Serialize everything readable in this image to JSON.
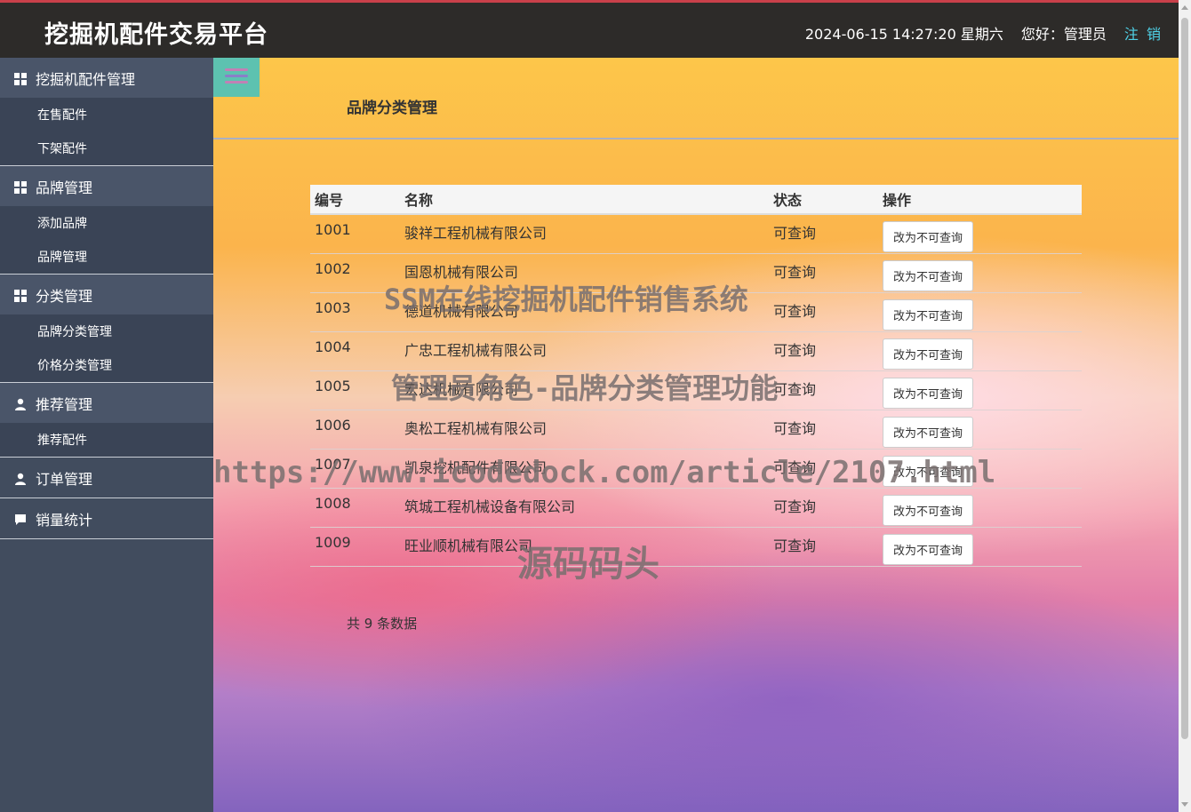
{
  "header": {
    "app_title": "挖掘机配件交易平台",
    "clock": "2024-06-15 14:27:20 星期六",
    "greeting": "您好：管理员",
    "logout": "注 销"
  },
  "sidebar": {
    "groups": [
      {
        "label": "挖掘机配件管理",
        "icon": "grid-icon",
        "items": [
          "在售配件",
          "下架配件"
        ]
      },
      {
        "label": "品牌管理",
        "icon": "grid-icon",
        "items": [
          "添加品牌",
          "品牌管理"
        ]
      },
      {
        "label": "分类管理",
        "icon": "grid-icon",
        "items": [
          "品牌分类管理",
          "价格分类管理"
        ]
      },
      {
        "label": "推荐管理",
        "icon": "user-icon",
        "items": [
          "推荐配件"
        ]
      },
      {
        "label": "订单管理",
        "icon": "user-icon",
        "items": []
      },
      {
        "label": "销量统计",
        "icon": "comment-icon",
        "items": []
      }
    ]
  },
  "main": {
    "heading": "品牌分类管理",
    "table": {
      "headers": [
        "编号",
        "名称",
        "状态",
        "操作"
      ],
      "rows": [
        {
          "id": "1001",
          "name": "骏祥工程机械有限公司",
          "status": "可查询",
          "action": "改为不可查询"
        },
        {
          "id": "1002",
          "name": "国恩机械有限公司",
          "status": "可查询",
          "action": "改为不可查询"
        },
        {
          "id": "1003",
          "name": "德道机械有限公司",
          "status": "可查询",
          "action": "改为不可查询"
        },
        {
          "id": "1004",
          "name": "广忠工程机械有限公司",
          "status": "可查询",
          "action": "改为不可查询"
        },
        {
          "id": "1005",
          "name": "宏达机械有限公司",
          "status": "可查询",
          "action": "改为不可查询"
        },
        {
          "id": "1006",
          "name": "奥松工程机械有限公司",
          "status": "可查询",
          "action": "改为不可查询"
        },
        {
          "id": "1007",
          "name": "凯泉挖机配件有限公司",
          "status": "可查询",
          "action": "改为不可查询"
        },
        {
          "id": "1008",
          "name": "筑城工程机械设备有限公司",
          "status": "可查询",
          "action": "改为不可查询"
        },
        {
          "id": "1009",
          "name": "旺业顺机械有限公司",
          "status": "可查询",
          "action": "改为不可查询"
        }
      ]
    },
    "count_text": "共 9 条数据"
  },
  "watermarks": [
    "SSM在线挖掘机配件销售系统",
    "管理员角色-品牌分类管理功能",
    "https://www.icodedock.com/article/2107.html",
    "源码码头"
  ]
}
